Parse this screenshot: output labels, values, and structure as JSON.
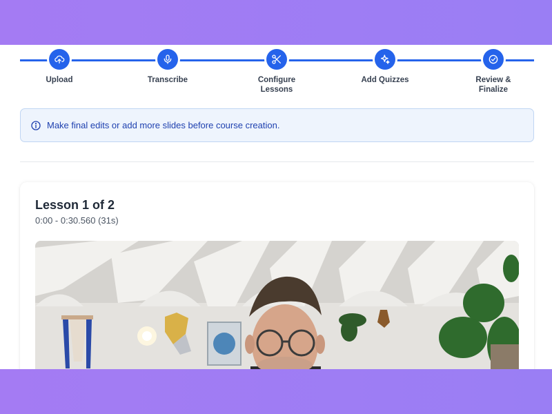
{
  "stepper": {
    "steps": [
      {
        "label": "Upload",
        "icon": "cloud-upload-icon"
      },
      {
        "label": "Transcribe",
        "icon": "microphone-icon"
      },
      {
        "label": "Configure\nLessons",
        "icon": "scissors-icon"
      },
      {
        "label": "Add Quizzes",
        "icon": "sparkles-icon"
      },
      {
        "label": "Review &\nFinalize",
        "icon": "check-circle-icon"
      }
    ],
    "color": "#2563eb"
  },
  "info": {
    "icon": "info-icon",
    "message": "Make final edits or add more slides before course creation."
  },
  "lesson": {
    "title": "Lesson 1 of 2",
    "time_range": "0:00 - 0:30.560 (31s)"
  },
  "video": {
    "description_icon": "video-preview"
  }
}
